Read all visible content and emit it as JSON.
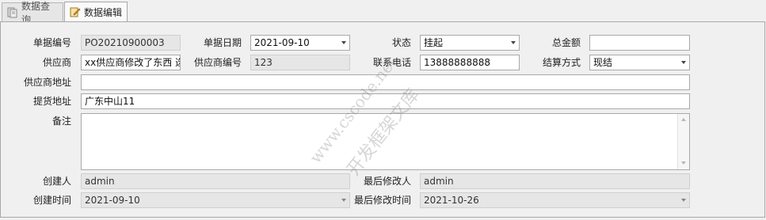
{
  "tabs": [
    {
      "label": "数据查询",
      "icon": "query-icon"
    },
    {
      "label": "数据编辑",
      "icon": "edit-icon"
    }
  ],
  "form": {
    "doc_no": {
      "label": "单据编号",
      "value": "PO20210900003"
    },
    "doc_date": {
      "label": "单据日期",
      "value": "2021-09-10"
    },
    "status": {
      "label": "状态",
      "value": "挂起"
    },
    "total_amount": {
      "label": "总金额",
      "value": ""
    },
    "supplier": {
      "label": "供应商",
      "value": "xx供应商修改了东西 选"
    },
    "supplier_code": {
      "label": "供应商编号",
      "value": "123"
    },
    "phone": {
      "label": "联系电话",
      "value": "13888888888"
    },
    "settlement": {
      "label": "结算方式",
      "value": "现结"
    },
    "supplier_address": {
      "label": "供应商地址",
      "value": ""
    },
    "pickup_address": {
      "label": "提货地址",
      "value": "广东中山11"
    },
    "remark": {
      "label": "备注",
      "value": ""
    },
    "creator": {
      "label": "创建人",
      "value": "admin"
    },
    "last_modifier": {
      "label": "最后修改人",
      "value": "admin"
    },
    "created_time": {
      "label": "创建时间",
      "value": "2021-09-10"
    },
    "last_modified_time": {
      "label": "最后修改时间",
      "value": "2021-10-26"
    }
  },
  "watermark": {
    "line1": "www.cscode.net",
    "line2": "开发框架文库"
  }
}
